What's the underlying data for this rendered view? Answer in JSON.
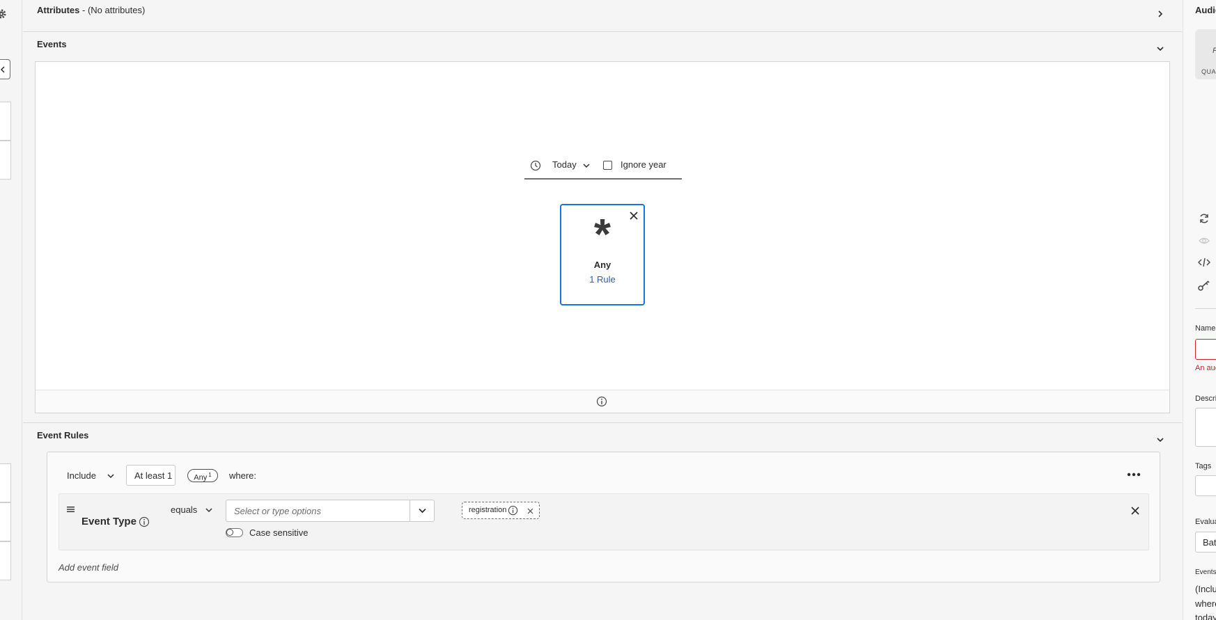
{
  "attributes": {
    "title": "Attributes",
    "subtitle": "- (No attributes)"
  },
  "events": {
    "title": "Events",
    "time_filter": {
      "value": "Today",
      "ignore_year_label": "Ignore year"
    },
    "card": {
      "symbol": "*",
      "title": "Any",
      "rule_count": "1 Rule"
    }
  },
  "event_rules": {
    "title": "Event Rules",
    "include_label": "Include",
    "count_label": "At least 1",
    "any_badge": "Any",
    "any_badge_sup": "1",
    "where_label": "where:",
    "rule": {
      "field_label": "Event Type",
      "operator": "equals",
      "value_placeholder": "Select or type options",
      "tag": "registration",
      "case_sensitive_label": "Case sensitive"
    },
    "add_field_label": "Add event field"
  },
  "right_panel": {
    "title": "Audie",
    "card_letter": "F",
    "card_caption": "QUA",
    "name_label": "Name",
    "name_error": "An auc",
    "description_label": "Descri",
    "tags_label": "Tags",
    "evaluation_label": "Evalua",
    "evaluation_value": "Bat",
    "events_label": "Events",
    "events_summary_1": "(Inclu",
    "events_summary_2": "where",
    "events_summary_3": "today"
  },
  "colors": {
    "accent": "#1473e6",
    "link": "#2d5fa1",
    "error": "#c9252d"
  }
}
